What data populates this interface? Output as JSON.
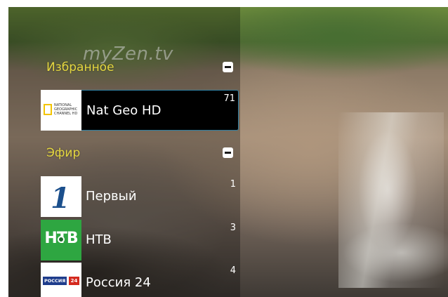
{
  "watermark": "myZen.tv",
  "groups": [
    {
      "title": "Избранное",
      "channels": [
        {
          "name": "Nat Geo HD",
          "number": "71",
          "logo_text": "NATIONAL GEOGRAPHIC CHANNEL HD",
          "icon": "natgeo-logo-icon",
          "selected": true
        }
      ]
    },
    {
      "title": "Эфир",
      "channels": [
        {
          "name": "Первый",
          "number": "1",
          "logo_text": "1",
          "icon": "perviy-logo-icon"
        },
        {
          "name": "НТВ",
          "number": "3",
          "logo_text": "НТВ",
          "icon": "ntv-logo-icon"
        },
        {
          "name": "Россия 24",
          "number": "4",
          "logo_text": "РОССИЯ",
          "logo_num": "24",
          "icon": "rossiya24-logo-icon"
        }
      ]
    }
  ],
  "colors": {
    "group_title": "#e5d740",
    "selection_border": "#2f7fa3",
    "natgeo_yellow": "#f3c400",
    "ntv_green": "#2ea641",
    "rossiya_blue": "#1f3d8c",
    "rossiya_red": "#d42a1f"
  }
}
